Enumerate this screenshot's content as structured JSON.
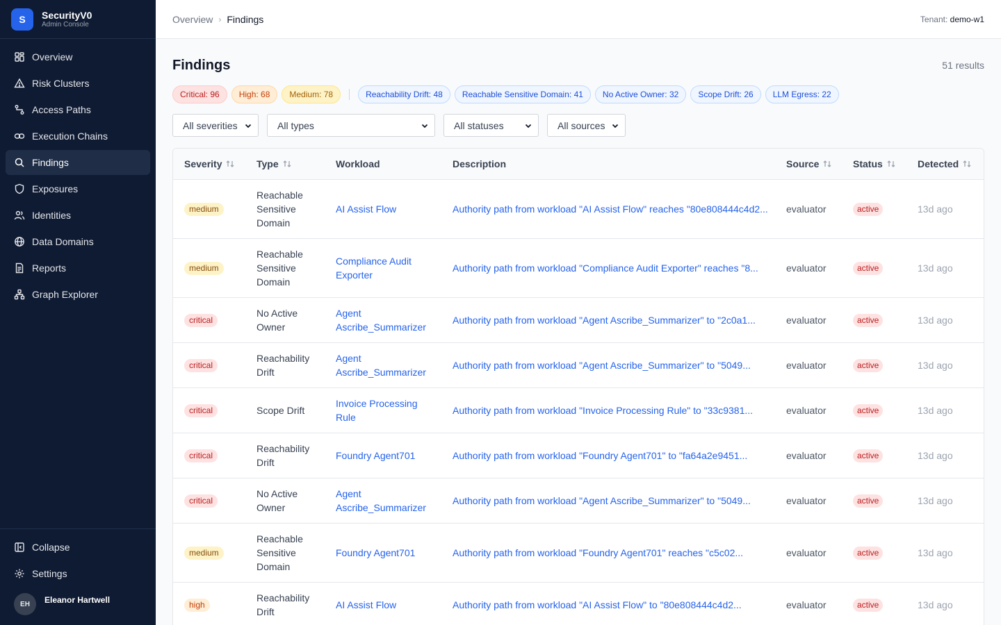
{
  "brand": {
    "logo_letter": "S",
    "name": "SecurityV0",
    "subtitle": "Admin Console"
  },
  "sidebar": {
    "items": [
      {
        "label": "Overview",
        "icon": "grid-icon"
      },
      {
        "label": "Risk Clusters",
        "icon": "warning-icon"
      },
      {
        "label": "Access Paths",
        "icon": "route-icon"
      },
      {
        "label": "Execution Chains",
        "icon": "link-icon"
      },
      {
        "label": "Findings",
        "icon": "search-icon",
        "active": true
      },
      {
        "label": "Exposures",
        "icon": "shield-icon"
      },
      {
        "label": "Identities",
        "icon": "users-icon"
      },
      {
        "label": "Data Domains",
        "icon": "globe-icon"
      },
      {
        "label": "Reports",
        "icon": "document-icon"
      },
      {
        "label": "Graph Explorer",
        "icon": "network-icon"
      }
    ],
    "collapse_label": "Collapse",
    "settings_label": "Settings",
    "user": {
      "initials": "EH",
      "name": "Eleanor Hartwell"
    }
  },
  "header": {
    "breadcrumb": [
      "Overview",
      "Findings"
    ],
    "tenant_label": "Tenant:",
    "tenant_value": "demo-w1"
  },
  "main": {
    "title": "Findings",
    "results": "51 results",
    "severity_chips": [
      {
        "label": "Critical: 96",
        "tone": "red"
      },
      {
        "label": "High: 68",
        "tone": "orange"
      },
      {
        "label": "Medium: 78",
        "tone": "yellow"
      }
    ],
    "type_chips": [
      "Reachability Drift: 48",
      "Reachable Sensitive Domain: 41",
      "No Active Owner: 32",
      "Scope Drift: 26",
      "LLM Egress: 22"
    ],
    "filters": [
      "All severities",
      "All types",
      "All statuses",
      "All sources"
    ],
    "columns": [
      "Severity",
      "Type",
      "Workload",
      "Description",
      "Source",
      "Status",
      "Detected"
    ],
    "rows": [
      {
        "severity": "medium",
        "type": "Reachable Sensitive Domain",
        "workload": "AI Assist Flow",
        "description": "Authority path from workload \"AI Assist Flow\" reaches \"80e808444c4d2...",
        "source": "evaluator",
        "status": "active",
        "detected": "13d ago"
      },
      {
        "severity": "medium",
        "type": "Reachable Sensitive Domain",
        "workload": "Compliance Audit Exporter",
        "description": "Authority path from workload \"Compliance Audit Exporter\" reaches \"8...",
        "source": "evaluator",
        "status": "active",
        "detected": "13d ago"
      },
      {
        "severity": "critical",
        "type": "No Active Owner",
        "workload": "Agent Ascribe_Summarizer",
        "description": "Authority path from workload \"Agent Ascribe_Summarizer\" to \"2c0a1...",
        "source": "evaluator",
        "status": "active",
        "detected": "13d ago"
      },
      {
        "severity": "critical",
        "type": "Reachability Drift",
        "workload": "Agent Ascribe_Summarizer",
        "description": "Authority path from workload \"Agent Ascribe_Summarizer\" to \"5049...",
        "source": "evaluator",
        "status": "active",
        "detected": "13d ago"
      },
      {
        "severity": "critical",
        "type": "Scope Drift",
        "workload": "Invoice Processing Rule",
        "description": "Authority path from workload \"Invoice Processing Rule\" to \"33c9381...",
        "source": "evaluator",
        "status": "active",
        "detected": "13d ago"
      },
      {
        "severity": "critical",
        "type": "Reachability Drift",
        "workload": "Foundry Agent701",
        "description": "Authority path from workload \"Foundry Agent701\" to \"fa64a2e9451...",
        "source": "evaluator",
        "status": "active",
        "detected": "13d ago"
      },
      {
        "severity": "critical",
        "type": "No Active Owner",
        "workload": "Agent Ascribe_Summarizer",
        "description": "Authority path from workload \"Agent Ascribe_Summarizer\" to \"5049...",
        "source": "evaluator",
        "status": "active",
        "detected": "13d ago"
      },
      {
        "severity": "medium",
        "type": "Reachable Sensitive Domain",
        "workload": "Foundry Agent701",
        "description": "Authority path from workload \"Foundry Agent701\" reaches \"c5c02...",
        "source": "evaluator",
        "status": "active",
        "detected": "13d ago"
      },
      {
        "severity": "high",
        "type": "Reachability Drift",
        "workload": "AI Assist Flow",
        "description": "Authority path from workload \"AI Assist Flow\" to \"80e808444c4d2...",
        "source": "evaluator",
        "status": "active",
        "detected": "13d ago"
      }
    ]
  }
}
